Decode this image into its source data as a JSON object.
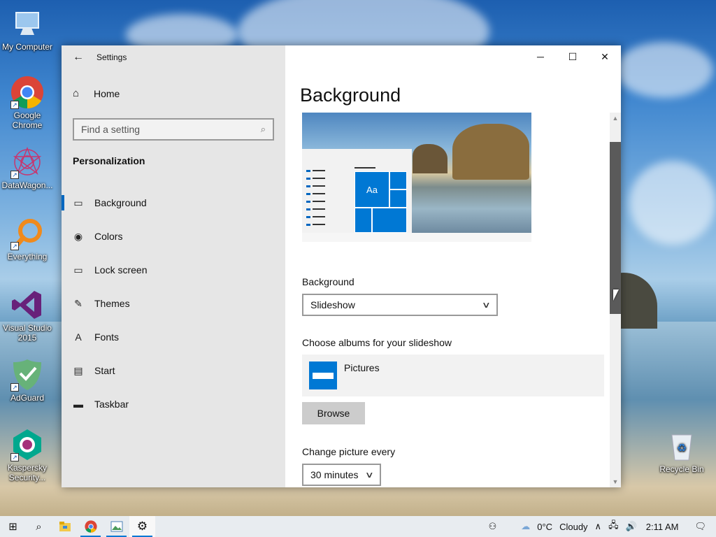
{
  "desktop": {
    "icons": [
      {
        "label": "My Computer",
        "icon": "computer-icon"
      },
      {
        "label": "Google Chrome",
        "icon": "chrome-icon"
      },
      {
        "label": "DataWagon...",
        "icon": "datawagon-icon"
      },
      {
        "label": "Everything",
        "icon": "everything-search-icon"
      },
      {
        "label": "Visual Studio 2015",
        "icon": "visual-studio-icon"
      },
      {
        "label": "AdGuard",
        "icon": "adguard-shield-icon"
      },
      {
        "label": "Kaspersky Security...",
        "icon": "kaspersky-icon"
      },
      {
        "label": "Recycle Bin",
        "icon": "recycle-bin-icon"
      }
    ]
  },
  "window": {
    "app_title": "Settings",
    "controls": {
      "minimize": "─",
      "maximize": "☐",
      "close": "✕"
    }
  },
  "nav": {
    "back_icon": "←",
    "home_label": "Home",
    "home_icon": "⌂",
    "search_placeholder": "Find a setting",
    "search_icon": "⌕",
    "section_title": "Personalization",
    "items": [
      {
        "label": "Background",
        "icon": "▭",
        "active": true
      },
      {
        "label": "Colors",
        "icon": "◉",
        "active": false
      },
      {
        "label": "Lock screen",
        "icon": "▭",
        "active": false
      },
      {
        "label": "Themes",
        "icon": "✎",
        "active": false
      },
      {
        "label": "Fonts",
        "icon": "A",
        "active": false
      },
      {
        "label": "Start",
        "icon": "▤",
        "active": false
      },
      {
        "label": "Taskbar",
        "icon": "▬",
        "active": false
      }
    ]
  },
  "content": {
    "title": "Background",
    "preview_tile_text": "Aa",
    "background_label": "Background",
    "background_value": "Slideshow",
    "albums_label": "Choose albums for your slideshow",
    "album_name": "Pictures",
    "browse_label": "Browse",
    "change_every_label": "Change picture every",
    "change_every_value": "30 minutes"
  },
  "taskbar": {
    "start_icon": "⊞",
    "search_icon": "⌕",
    "apps": [
      "file-explorer-icon",
      "chrome-icon",
      "photos-icon",
      "settings-gear-icon"
    ],
    "tray": {
      "people_icon": "⚇",
      "weather_temp": "0°C",
      "weather_text": "Cloudy",
      "chevron": "∧",
      "clock": "2:11 AM"
    }
  }
}
